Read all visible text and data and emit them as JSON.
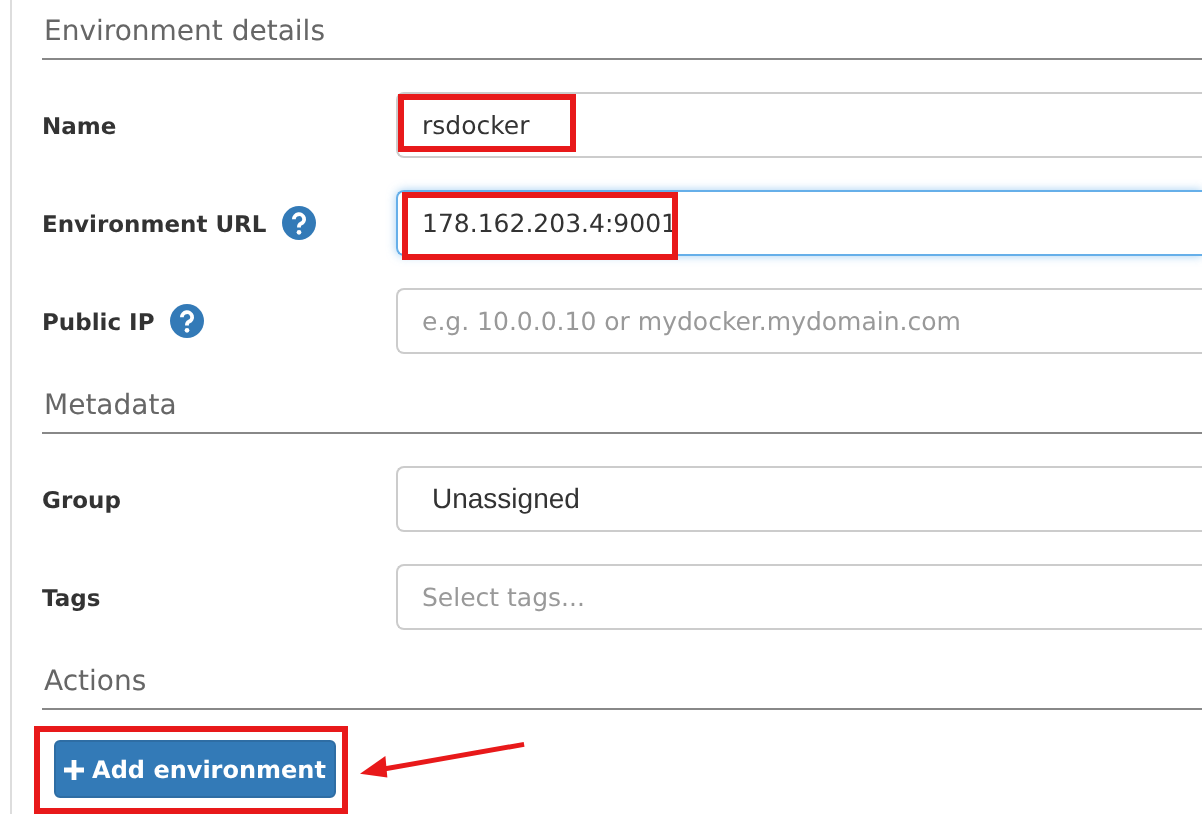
{
  "sections": [
    {
      "title": "Environment details",
      "fields": [
        {
          "label": "Name",
          "kind": "text",
          "value": "rsdocker",
          "help": false,
          "focused": false,
          "highlighted": true
        },
        {
          "label": "Environment URL",
          "kind": "text",
          "value": "178.162.203.4:9001",
          "help": true,
          "focused": true,
          "highlighted": true
        },
        {
          "label": "Public IP",
          "kind": "text",
          "placeholder": "e.g. 10.0.0.10 or mydocker.mydomain.com",
          "help": true,
          "focused": false,
          "highlighted": false
        }
      ]
    },
    {
      "title": "Metadata",
      "fields": [
        {
          "label": "Group",
          "kind": "select",
          "value": "Unassigned",
          "help": false,
          "focused": false,
          "highlighted": false
        },
        {
          "label": "Tags",
          "kind": "text",
          "placeholder": "Select tags...",
          "help": false,
          "focused": false,
          "highlighted": false
        }
      ]
    },
    {
      "title": "Actions",
      "button": {
        "label": "Add environment",
        "highlighted": true,
        "pointed": true
      }
    }
  ]
}
